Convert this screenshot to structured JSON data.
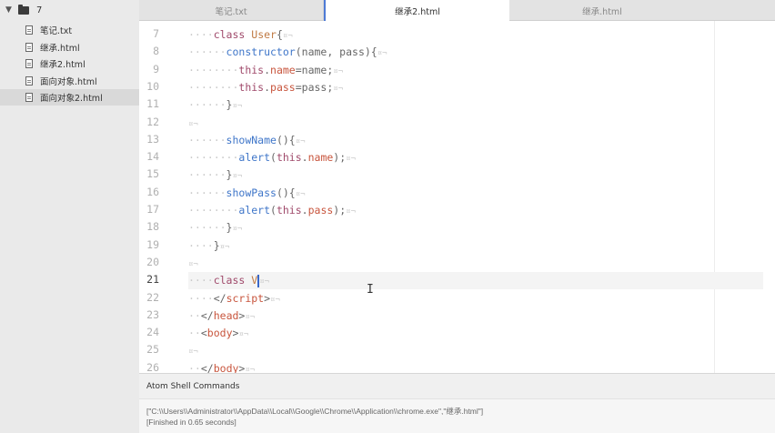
{
  "sidebar": {
    "root_label": "7",
    "files": [
      {
        "label": "笔记.txt",
        "selected": false
      },
      {
        "label": "继承.html",
        "selected": false
      },
      {
        "label": "继承2.html",
        "selected": false
      },
      {
        "label": "面向对象.html",
        "selected": false
      },
      {
        "label": "面向对象2.html",
        "selected": true
      }
    ]
  },
  "tabs": [
    {
      "label": "笔记.txt",
      "active": false
    },
    {
      "label": "继承2.html",
      "active": true
    },
    {
      "label": "继承.html",
      "active": false
    }
  ],
  "editor": {
    "current_line": "21",
    "lines": [
      {
        "num": "7",
        "tokens": [
          [
            "ws",
            "····"
          ],
          [
            "kw",
            "class"
          ],
          [
            "br",
            " "
          ],
          [
            "cls",
            "User"
          ],
          [
            "br",
            "{"
          ],
          [
            "mark",
            "¤¬"
          ]
        ]
      },
      {
        "num": "8",
        "tokens": [
          [
            "ws",
            "······"
          ],
          [
            "fn",
            "constructor"
          ],
          [
            "br",
            "(name, pass){"
          ],
          [
            "mark",
            "¤¬"
          ]
        ]
      },
      {
        "num": "9",
        "tokens": [
          [
            "ws",
            "········"
          ],
          [
            "kw",
            "this"
          ],
          [
            "br",
            "."
          ],
          [
            "prop",
            "name"
          ],
          [
            "br",
            "=name;"
          ],
          [
            "mark",
            "¤¬"
          ]
        ]
      },
      {
        "num": "10",
        "tokens": [
          [
            "ws",
            "········"
          ],
          [
            "kw",
            "this"
          ],
          [
            "br",
            "."
          ],
          [
            "prop",
            "pass"
          ],
          [
            "br",
            "=pass;"
          ],
          [
            "mark",
            "¤¬"
          ]
        ]
      },
      {
        "num": "11",
        "tokens": [
          [
            "ws",
            "······"
          ],
          [
            "br",
            "}"
          ],
          [
            "mark",
            "¤¬"
          ]
        ]
      },
      {
        "num": "12",
        "tokens": [
          [
            "mark",
            "¤¬"
          ]
        ]
      },
      {
        "num": "13",
        "tokens": [
          [
            "ws",
            "······"
          ],
          [
            "fn",
            "showName"
          ],
          [
            "br",
            "(){"
          ],
          [
            "mark",
            "¤¬"
          ]
        ]
      },
      {
        "num": "14",
        "tokens": [
          [
            "ws",
            "········"
          ],
          [
            "fn",
            "alert"
          ],
          [
            "br",
            "("
          ],
          [
            "kw",
            "this"
          ],
          [
            "br",
            "."
          ],
          [
            "prop",
            "name"
          ],
          [
            "br",
            ");"
          ],
          [
            "mark",
            "¤¬"
          ]
        ]
      },
      {
        "num": "15",
        "tokens": [
          [
            "ws",
            "······"
          ],
          [
            "br",
            "}"
          ],
          [
            "mark",
            "¤¬"
          ]
        ]
      },
      {
        "num": "16",
        "tokens": [
          [
            "ws",
            "······"
          ],
          [
            "fn",
            "showPass"
          ],
          [
            "br",
            "(){"
          ],
          [
            "mark",
            "¤¬"
          ]
        ]
      },
      {
        "num": "17",
        "tokens": [
          [
            "ws",
            "········"
          ],
          [
            "fn",
            "alert"
          ],
          [
            "br",
            "("
          ],
          [
            "kw",
            "this"
          ],
          [
            "br",
            "."
          ],
          [
            "prop",
            "pass"
          ],
          [
            "br",
            ");"
          ],
          [
            "mark",
            "¤¬"
          ]
        ]
      },
      {
        "num": "18",
        "tokens": [
          [
            "ws",
            "······"
          ],
          [
            "br",
            "}"
          ],
          [
            "mark",
            "¤¬"
          ]
        ]
      },
      {
        "num": "19",
        "tokens": [
          [
            "ws",
            "····"
          ],
          [
            "br",
            "}"
          ],
          [
            "mark",
            "¤¬"
          ]
        ]
      },
      {
        "num": "20",
        "tokens": [
          [
            "mark",
            "¤¬"
          ]
        ]
      },
      {
        "num": "21",
        "tokens": [
          [
            "ws",
            "····"
          ],
          [
            "kw",
            "class"
          ],
          [
            "br",
            " "
          ],
          [
            "cls",
            "V"
          ],
          [
            "mark",
            "¤¬"
          ]
        ]
      },
      {
        "num": "22",
        "tokens": [
          [
            "ws",
            "····"
          ],
          [
            "br",
            "</"
          ],
          [
            "tag",
            "script"
          ],
          [
            "br",
            ">"
          ],
          [
            "mark",
            "¤¬"
          ]
        ]
      },
      {
        "num": "23",
        "tokens": [
          [
            "ws",
            "··"
          ],
          [
            "br",
            "</"
          ],
          [
            "tag",
            "head"
          ],
          [
            "br",
            ">"
          ],
          [
            "mark",
            "¤¬"
          ]
        ]
      },
      {
        "num": "24",
        "tokens": [
          [
            "ws",
            "··"
          ],
          [
            "br",
            "<"
          ],
          [
            "tag",
            "body"
          ],
          [
            "br",
            ">"
          ],
          [
            "mark",
            "¤¬"
          ]
        ]
      },
      {
        "num": "25",
        "tokens": [
          [
            "mark",
            "¤¬"
          ]
        ]
      },
      {
        "num": "26",
        "tokens": [
          [
            "ws",
            "··"
          ],
          [
            "br",
            "</"
          ],
          [
            "tag",
            "body"
          ],
          [
            "br",
            ">"
          ],
          [
            "mark",
            "¤¬"
          ]
        ]
      }
    ]
  },
  "panel": {
    "title": "Atom Shell Commands",
    "output": [
      "[\"C:\\\\Users\\\\Administrator\\\\AppData\\\\Local\\\\Google\\\\Chrome\\\\Application\\\\chrome.exe\",\"继承.html\"]",
      "[Finished in 0.65 seconds]"
    ]
  }
}
